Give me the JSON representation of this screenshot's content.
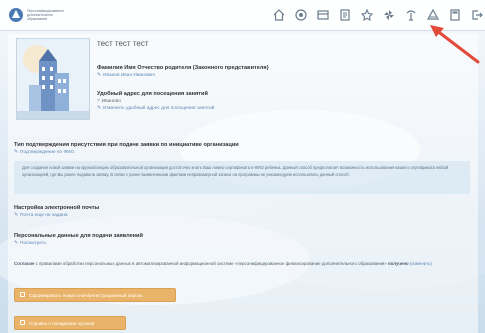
{
  "header": {
    "logo_text": "Персонифицированное дополнительное образование",
    "icons": [
      "home-icon",
      "help-icon",
      "catalog-icon",
      "documents-icon",
      "favorites-icon",
      "pinwheel-icon",
      "events-icon",
      "user-profile-icon",
      "calculator-icon",
      "logout-icon"
    ]
  },
  "profile": {
    "name": "тест тест тест",
    "parent_label": "Фамилия Имя Отчество родителя (Законного представителя)",
    "parent_value": "Иванов Иван Иванович",
    "address_label": "Удобный адрес для посещения занятий",
    "address_value": "Иваново",
    "address_change_link": "Изменить удобный адрес для посещения занятий"
  },
  "attendance": {
    "label": "Тип подтверждения присутствия при подаче заявки по инициативе организации",
    "value": "Подтверждение по ФИО"
  },
  "hint_text": "Для создания новой заявки на кружок/секцию образовательной организации достаточно знать Ваш номер сертификата и ФИО ребенка. Данный способ предполагает возможность использования вашего сертификата любой организацией, где Вы ранее подавали заявку. В связи с ранее выявленными фактами неправомерной записи на программы не рекомендуем использовать данный способ.",
  "email": {
    "label": "Настройка электронной почты",
    "link": "Почта еще не задана"
  },
  "personal_data": {
    "label": "Персональные данные для подачи заявлений",
    "link": "Посмотреть"
  },
  "consent": {
    "prefix": "Согласие",
    "middle": "с правилами обработки персональных данных в автоматизированной информационной системе «персонифицированное финансирование дополнительного образования»",
    "received": "получено",
    "change": "(изменить)"
  },
  "buttons": {
    "form_number": "Сформировать новую ключ/регистрационный пароль",
    "certificate": "Справка о поощрении органов"
  },
  "colors": {
    "accent": "#5e86b5",
    "button": "#e9b46a",
    "arrow": "#e24a3b"
  }
}
